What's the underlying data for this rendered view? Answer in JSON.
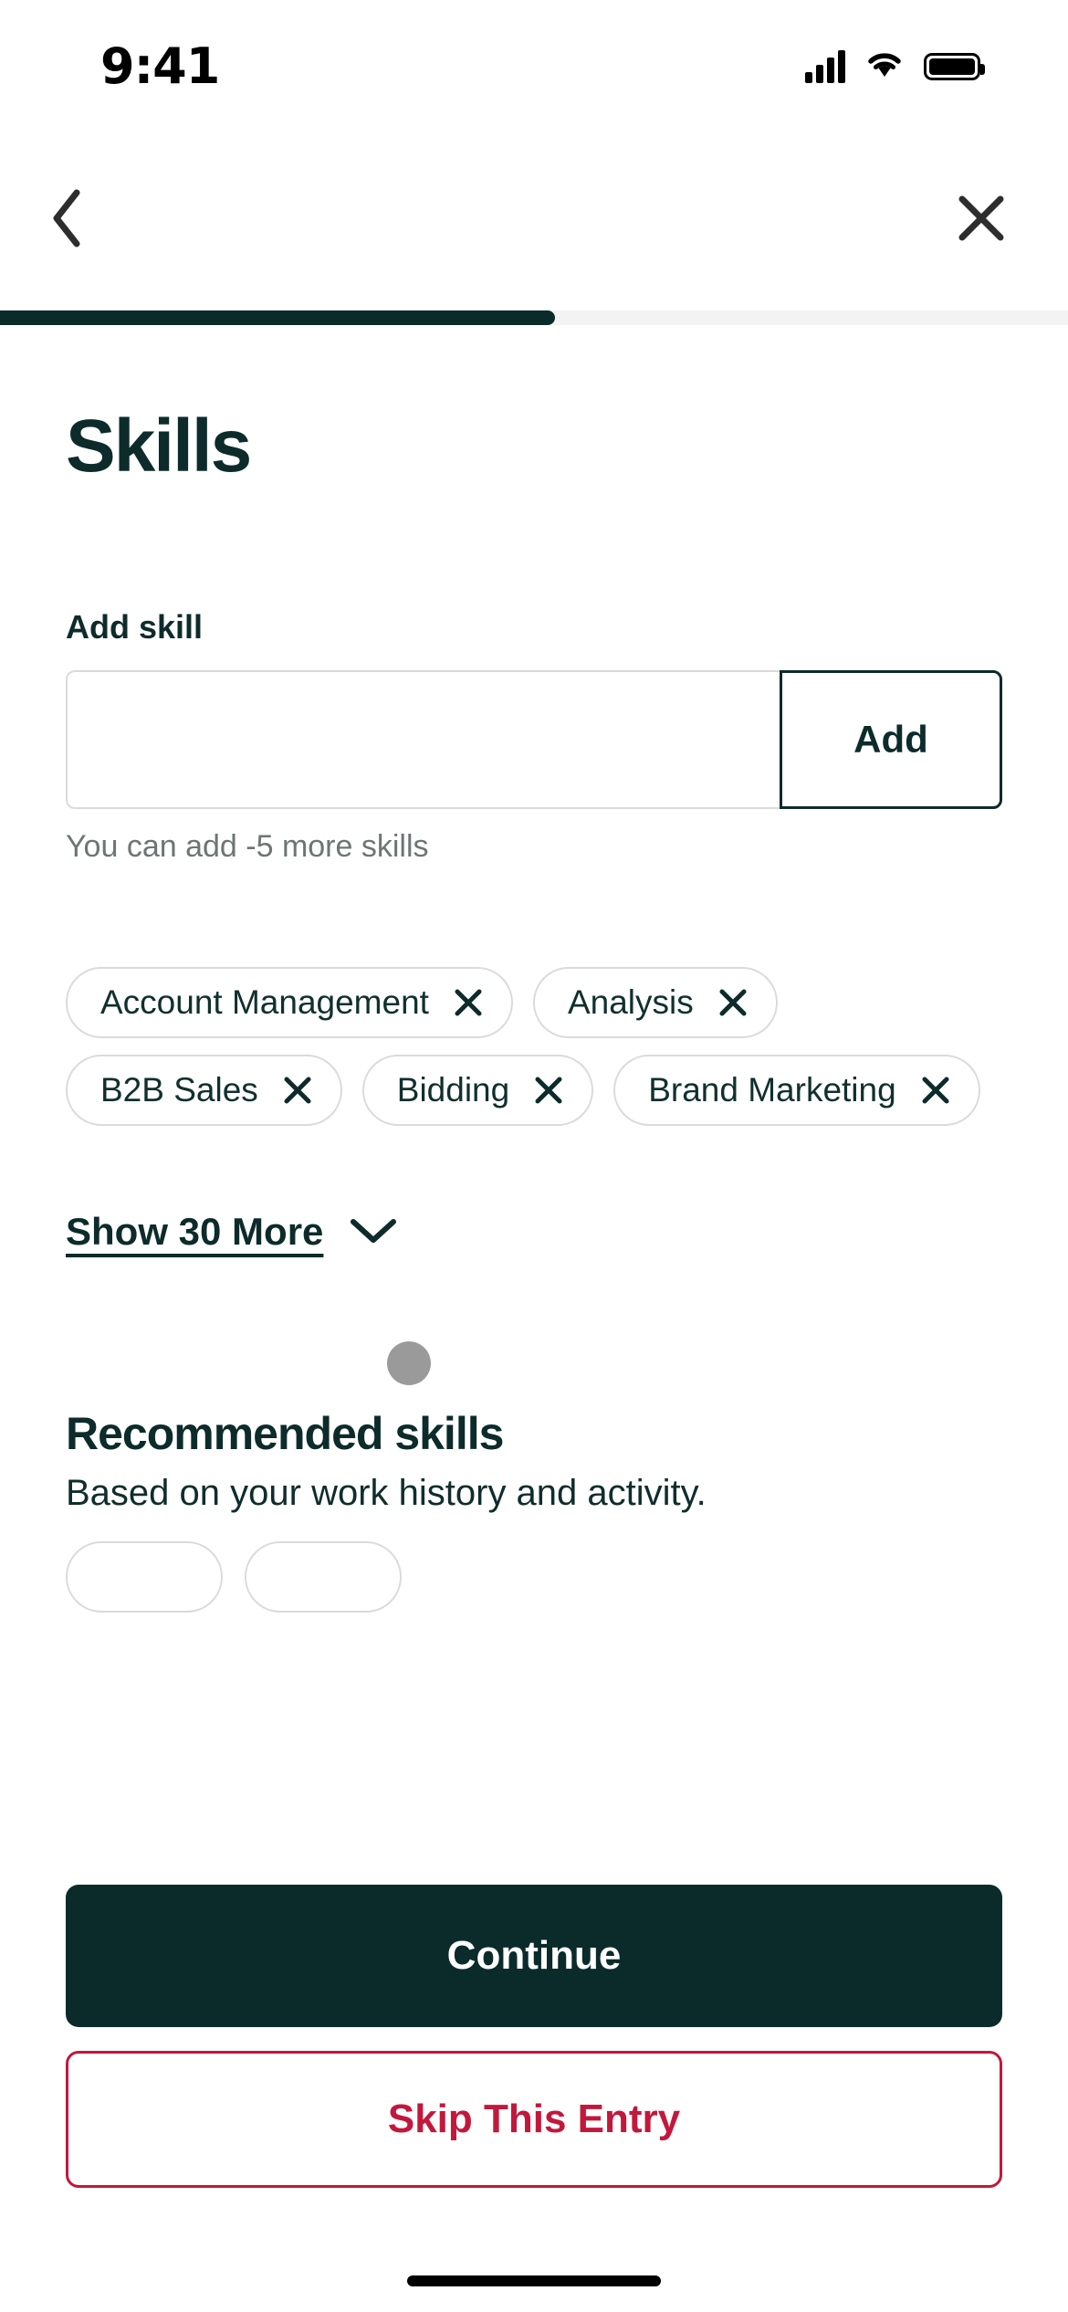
{
  "status_bar": {
    "time": "9:41",
    "signal_icon": "cellular-signal-icon",
    "wifi_icon": "wifi-icon",
    "battery_icon": "battery-icon"
  },
  "nav": {
    "back_icon": "chevron-left-icon",
    "close_icon": "close-icon"
  },
  "progress": {
    "percent": 52,
    "fill_color": "#0b2b2b",
    "track_color": "#f2f3f2"
  },
  "page": {
    "title": "Skills"
  },
  "add_skill": {
    "label": "Add skill",
    "input_value": "",
    "input_placeholder": "",
    "button_label": "Add",
    "helper_text": "You can add -5 more skills"
  },
  "skills": [
    {
      "label": "Account Management",
      "remove_icon": "close-icon"
    },
    {
      "label": "Analysis",
      "remove_icon": "close-icon"
    },
    {
      "label": "B2B Sales",
      "remove_icon": "close-icon"
    },
    {
      "label": "Bidding",
      "remove_icon": "close-icon"
    },
    {
      "label": "Brand Marketing",
      "remove_icon": "close-icon"
    }
  ],
  "show_more": {
    "label": "Show 30 More",
    "chevron_icon": "chevron-down-icon"
  },
  "recommended": {
    "title": "Recommended skills",
    "subtitle": "Based on your work history and activity."
  },
  "footer": {
    "continue_label": "Continue",
    "skip_label": "Skip This Entry",
    "primary_color": "#0b2b2b",
    "danger_color": "#c2183c"
  }
}
